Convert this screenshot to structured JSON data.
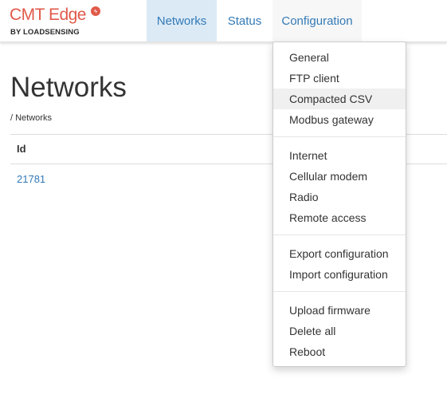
{
  "brand": {
    "name": "CMT Edge",
    "subtitle": "BY LOADSENSING",
    "logo_icon": "loadsensing-logo-icon",
    "color": "#e05a4a"
  },
  "nav": {
    "items": [
      {
        "label": "Networks",
        "active": true
      },
      {
        "label": "Status",
        "active": false
      },
      {
        "label": "Configuration",
        "open": true
      }
    ]
  },
  "page": {
    "title": "Networks",
    "breadcrumb": "/ Networks"
  },
  "table": {
    "columns": [
      "Id"
    ],
    "rows": [
      {
        "id": "21781"
      }
    ]
  },
  "dropdown": {
    "groups": [
      [
        "General",
        "FTP client",
        "Compacted CSV",
        "Modbus gateway"
      ],
      [
        "Internet",
        "Cellular modem",
        "Radio",
        "Remote access"
      ],
      [
        "Export configuration",
        "Import configuration"
      ],
      [
        "Upload firmware",
        "Delete all",
        "Reboot"
      ]
    ],
    "highlighted": "Compacted CSV"
  },
  "colors": {
    "link": "#337ab7",
    "nav_active_bg": "#dceaf6",
    "hover_bg": "#f0f0f0"
  }
}
